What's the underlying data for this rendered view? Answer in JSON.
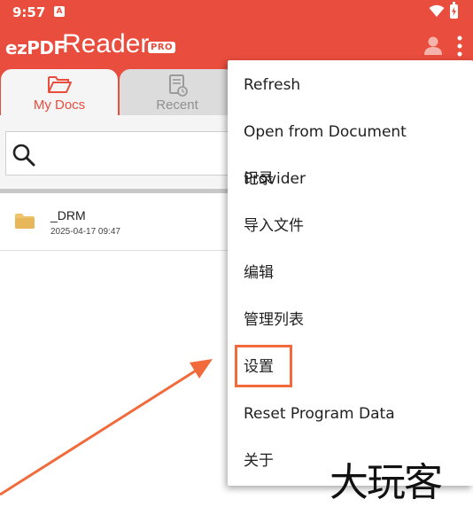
{
  "status_bar": {
    "time": "9:57",
    "notification_glyph": "A"
  },
  "header": {
    "logo_prefix": "ezPDF",
    "logo_name": "Reader",
    "logo_badge": "PRO",
    "background_color": "#e84d3d"
  },
  "tabs": [
    {
      "label": "My Docs",
      "icon": "folder-open-icon",
      "selected": true
    },
    {
      "label": "Recent",
      "icon": "recent-docs-icon",
      "selected": false
    }
  ],
  "search": {
    "placeholder": ""
  },
  "files": [
    {
      "name": "_DRM",
      "date": "2025-04-17 09:47",
      "icon": "folder-icon"
    }
  ],
  "menu": {
    "items": [
      {
        "label": "Refresh"
      },
      {
        "label": "Open from Document Provider"
      },
      {
        "label": "记录"
      },
      {
        "label": "导入文件"
      },
      {
        "label": "编辑"
      },
      {
        "label": "管理列表"
      },
      {
        "label": "设置"
      },
      {
        "label": "Reset Program Data"
      },
      {
        "label": "关于"
      }
    ],
    "highlighted_item": "设置",
    "highlight_color": "#f06a3c"
  },
  "watermark": {
    "text": "大玩客"
  }
}
